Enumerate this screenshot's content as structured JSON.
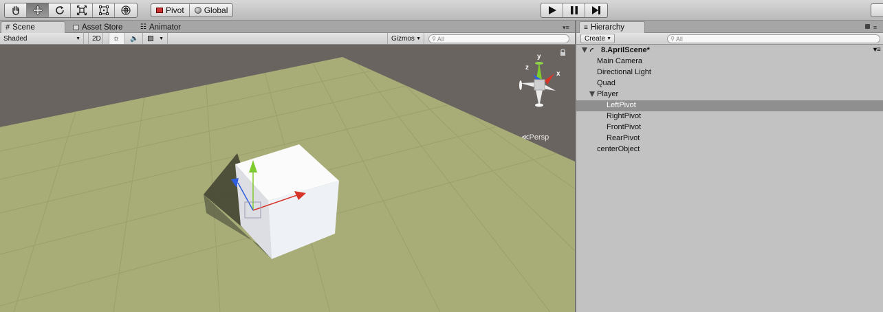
{
  "toolbar": {
    "tools": [
      {
        "name": "hand-tool",
        "icon": "hand-icon"
      },
      {
        "name": "move-tool",
        "icon": "move-icon",
        "active": true
      },
      {
        "name": "rotate-tool",
        "icon": "rotate-icon"
      },
      {
        "name": "scale-tool",
        "icon": "scale-icon"
      },
      {
        "name": "rect-tool",
        "icon": "rect-icon"
      },
      {
        "name": "transform-tool",
        "icon": "transform-icon"
      }
    ],
    "pivot_label": "Pivot",
    "global_label": "Global"
  },
  "scene": {
    "tabs": [
      {
        "label": "Scene",
        "icon": "grid-icon",
        "active": true
      },
      {
        "label": "Asset Store",
        "icon": "store-icon"
      },
      {
        "label": "Animator",
        "icon": "animator-icon"
      }
    ],
    "shading_mode": "Shaded",
    "mode_2d": "2D",
    "gizmos_label": "Gizmos",
    "search_placeholder": "All",
    "projection_label": "Persp",
    "gizmo_axes": {
      "x": "x",
      "y": "y",
      "z": "z"
    },
    "colors": {
      "ground": "#a8ad78",
      "background": "#6a6460",
      "x_axis": "#d8352a",
      "y_axis": "#7ecb2e",
      "z_axis": "#2f5ee0"
    }
  },
  "hierarchy": {
    "tab_label": "Hierarchy",
    "create_label": "Create",
    "search_placeholder": "All",
    "scene_name": "8.AprilScene*",
    "items": [
      {
        "label": "Main Camera",
        "depth": 1
      },
      {
        "label": "Directional Light",
        "depth": 1
      },
      {
        "label": "Quad",
        "depth": 1
      },
      {
        "label": "Player",
        "depth": 1,
        "expanded": true
      },
      {
        "label": "LeftPivot",
        "depth": 2,
        "selected": true
      },
      {
        "label": "RightPivot",
        "depth": 2
      },
      {
        "label": "FrontPivot",
        "depth": 2
      },
      {
        "label": "RearPivot",
        "depth": 2
      },
      {
        "label": "centerObject",
        "depth": 1
      }
    ]
  }
}
